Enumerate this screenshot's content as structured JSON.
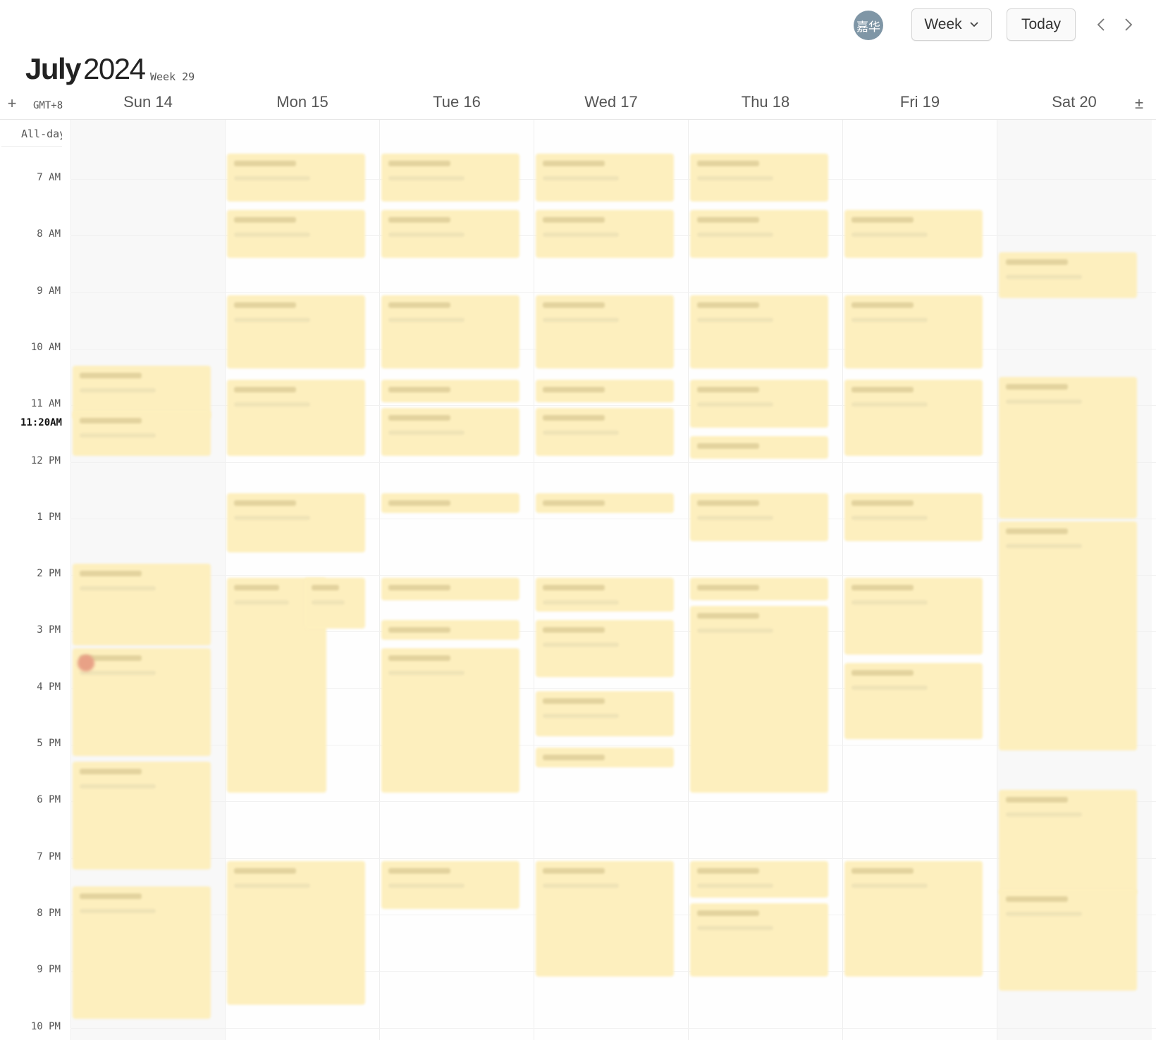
{
  "header": {
    "avatar_text": "嘉华",
    "view_label": "Week",
    "today_label": "Today",
    "month": "July",
    "year": "2024",
    "week_label": "Week 29",
    "timezone": "GMT+8",
    "add_symbol": "+",
    "zoom_symbol": "±"
  },
  "allday_label": "All-day",
  "days": [
    {
      "label": "Sun 14",
      "weekend": true
    },
    {
      "label": "Mon 15",
      "weekend": false
    },
    {
      "label": "Tue 16",
      "weekend": false
    },
    {
      "label": "Wed 17",
      "weekend": false
    },
    {
      "label": "Thu 18",
      "weekend": false
    },
    {
      "label": "Fri 19",
      "weekend": false
    },
    {
      "label": "Sat 20",
      "weekend": true
    }
  ],
  "hours": [
    "7 AM",
    "8 AM",
    "9 AM",
    "10 AM",
    "11 AM",
    "12 PM",
    "1 PM",
    "2 PM",
    "3 PM",
    "4 PM",
    "5 PM",
    "6 PM",
    "7 PM",
    "8 PM",
    "9 PM",
    "10 PM"
  ],
  "current_time": "11:20AM",
  "colors": {
    "event_fill": "#fdefbe",
    "event_text_blur": "#e3d39e",
    "avatar": "#7f96a6"
  }
}
